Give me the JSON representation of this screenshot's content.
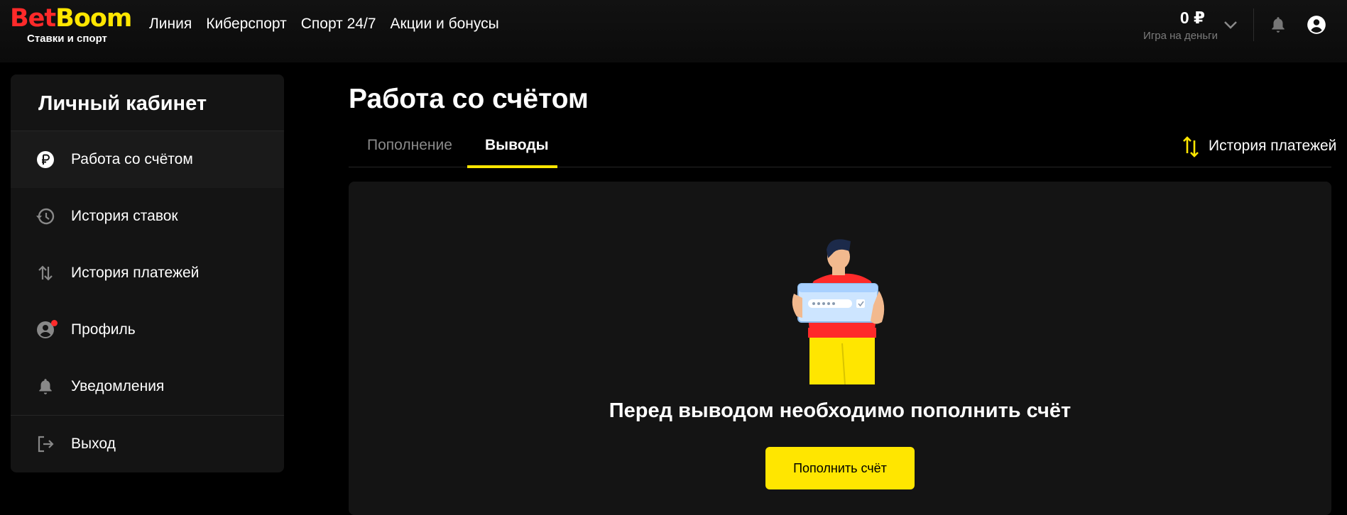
{
  "header": {
    "logo": {
      "bet": "Bet",
      "boom": "Boom",
      "subtitle": "Ставки и спорт"
    },
    "nav": [
      "Линия",
      "Киберспорт",
      "Спорт 24/7",
      "Акции и бонусы"
    ],
    "balance": {
      "amount": "0 ₽",
      "label": "Игра на деньги"
    },
    "icons": [
      "chevron-down-icon",
      "bell-icon",
      "user-icon"
    ]
  },
  "sidebar": {
    "title": "Личный кабинет",
    "items": [
      {
        "label": "Работа со счётом",
        "icon": "ruble-icon",
        "active": true
      },
      {
        "label": "История ставок",
        "icon": "history-icon"
      },
      {
        "label": "История платежей",
        "icon": "transfer-icon"
      },
      {
        "label": "Профиль",
        "icon": "profile-icon",
        "notification": true
      },
      {
        "label": "Уведомления",
        "icon": "bell-icon"
      },
      {
        "label": "Выход",
        "icon": "logout-icon"
      }
    ]
  },
  "main": {
    "title": "Работа со счётом",
    "tabs": [
      {
        "label": "Пополнение",
        "active": false
      },
      {
        "label": "Выводы",
        "active": true
      }
    ],
    "history_link": "История платежей",
    "empty_message": "Перед выводом необходимо пополнить счёт",
    "deposit_button": "Пополнить счёт"
  },
  "colors": {
    "accent": "#ffe600",
    "brand_red": "#ff2a2a",
    "background": "#000000",
    "panel": "#141414"
  }
}
